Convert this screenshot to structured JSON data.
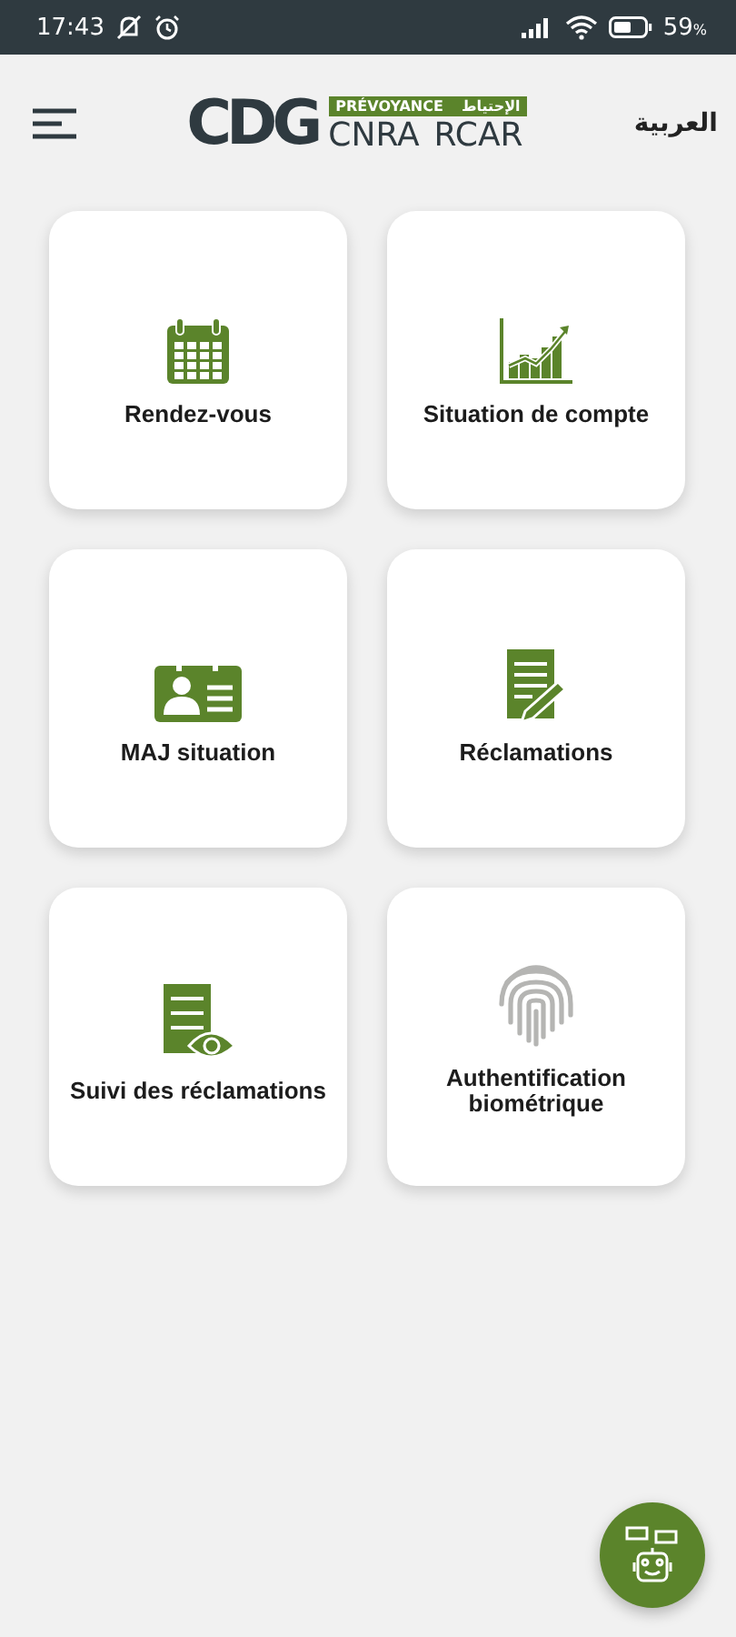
{
  "status_bar": {
    "time": "17:43",
    "battery": "59",
    "battery_unit": "%"
  },
  "header": {
    "logo_mark": "CDG",
    "logo_band_left": "PRÉVOYANCE",
    "logo_band_right": "الإحتياط",
    "logo_names": [
      "CNRA",
      "RCAR"
    ],
    "language": "العربية"
  },
  "tiles": [
    {
      "label": "Rendez-vous",
      "disabled": false
    },
    {
      "label": "Situation de compte",
      "disabled": false
    },
    {
      "label": "MAJ situation",
      "disabled": false
    },
    {
      "label": "Réclamations",
      "disabled": false
    },
    {
      "label": "Suivi des réclamations",
      "disabled": false
    },
    {
      "label": "Authentification biométrique",
      "disabled": true
    }
  ]
}
